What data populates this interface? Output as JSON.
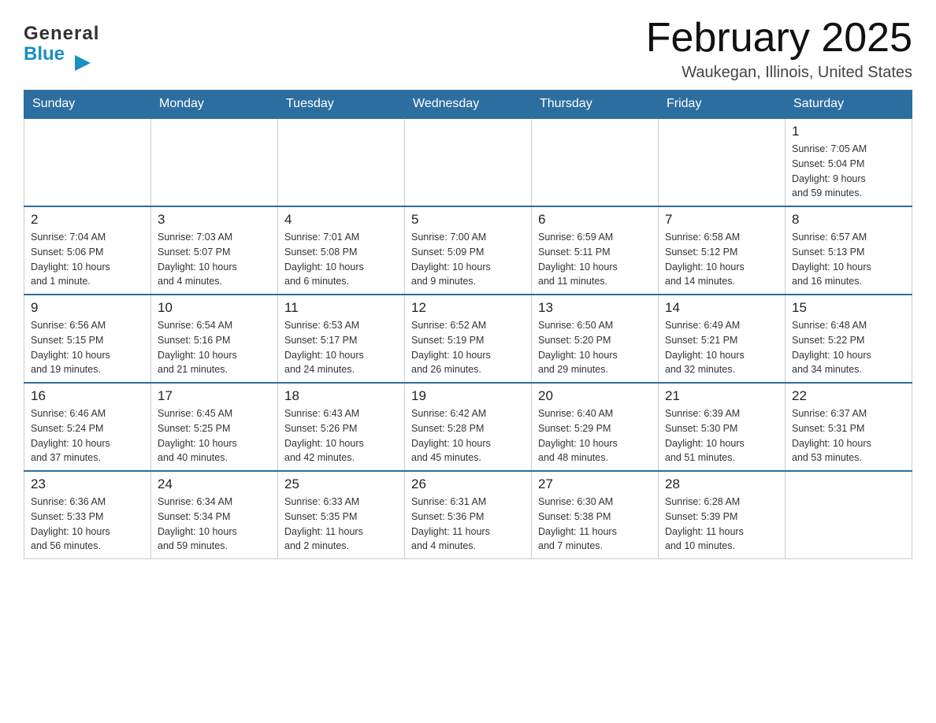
{
  "header": {
    "logo_general": "General",
    "logo_blue": "Blue",
    "title": "February 2025",
    "location": "Waukegan, Illinois, United States"
  },
  "days_of_week": [
    "Sunday",
    "Monday",
    "Tuesday",
    "Wednesday",
    "Thursday",
    "Friday",
    "Saturday"
  ],
  "weeks": [
    [
      {
        "day": "",
        "info": ""
      },
      {
        "day": "",
        "info": ""
      },
      {
        "day": "",
        "info": ""
      },
      {
        "day": "",
        "info": ""
      },
      {
        "day": "",
        "info": ""
      },
      {
        "day": "",
        "info": ""
      },
      {
        "day": "1",
        "info": "Sunrise: 7:05 AM\nSunset: 5:04 PM\nDaylight: 9 hours\nand 59 minutes."
      }
    ],
    [
      {
        "day": "2",
        "info": "Sunrise: 7:04 AM\nSunset: 5:06 PM\nDaylight: 10 hours\nand 1 minute."
      },
      {
        "day": "3",
        "info": "Sunrise: 7:03 AM\nSunset: 5:07 PM\nDaylight: 10 hours\nand 4 minutes."
      },
      {
        "day": "4",
        "info": "Sunrise: 7:01 AM\nSunset: 5:08 PM\nDaylight: 10 hours\nand 6 minutes."
      },
      {
        "day": "5",
        "info": "Sunrise: 7:00 AM\nSunset: 5:09 PM\nDaylight: 10 hours\nand 9 minutes."
      },
      {
        "day": "6",
        "info": "Sunrise: 6:59 AM\nSunset: 5:11 PM\nDaylight: 10 hours\nand 11 minutes."
      },
      {
        "day": "7",
        "info": "Sunrise: 6:58 AM\nSunset: 5:12 PM\nDaylight: 10 hours\nand 14 minutes."
      },
      {
        "day": "8",
        "info": "Sunrise: 6:57 AM\nSunset: 5:13 PM\nDaylight: 10 hours\nand 16 minutes."
      }
    ],
    [
      {
        "day": "9",
        "info": "Sunrise: 6:56 AM\nSunset: 5:15 PM\nDaylight: 10 hours\nand 19 minutes."
      },
      {
        "day": "10",
        "info": "Sunrise: 6:54 AM\nSunset: 5:16 PM\nDaylight: 10 hours\nand 21 minutes."
      },
      {
        "day": "11",
        "info": "Sunrise: 6:53 AM\nSunset: 5:17 PM\nDaylight: 10 hours\nand 24 minutes."
      },
      {
        "day": "12",
        "info": "Sunrise: 6:52 AM\nSunset: 5:19 PM\nDaylight: 10 hours\nand 26 minutes."
      },
      {
        "day": "13",
        "info": "Sunrise: 6:50 AM\nSunset: 5:20 PM\nDaylight: 10 hours\nand 29 minutes."
      },
      {
        "day": "14",
        "info": "Sunrise: 6:49 AM\nSunset: 5:21 PM\nDaylight: 10 hours\nand 32 minutes."
      },
      {
        "day": "15",
        "info": "Sunrise: 6:48 AM\nSunset: 5:22 PM\nDaylight: 10 hours\nand 34 minutes."
      }
    ],
    [
      {
        "day": "16",
        "info": "Sunrise: 6:46 AM\nSunset: 5:24 PM\nDaylight: 10 hours\nand 37 minutes."
      },
      {
        "day": "17",
        "info": "Sunrise: 6:45 AM\nSunset: 5:25 PM\nDaylight: 10 hours\nand 40 minutes."
      },
      {
        "day": "18",
        "info": "Sunrise: 6:43 AM\nSunset: 5:26 PM\nDaylight: 10 hours\nand 42 minutes."
      },
      {
        "day": "19",
        "info": "Sunrise: 6:42 AM\nSunset: 5:28 PM\nDaylight: 10 hours\nand 45 minutes."
      },
      {
        "day": "20",
        "info": "Sunrise: 6:40 AM\nSunset: 5:29 PM\nDaylight: 10 hours\nand 48 minutes."
      },
      {
        "day": "21",
        "info": "Sunrise: 6:39 AM\nSunset: 5:30 PM\nDaylight: 10 hours\nand 51 minutes."
      },
      {
        "day": "22",
        "info": "Sunrise: 6:37 AM\nSunset: 5:31 PM\nDaylight: 10 hours\nand 53 minutes."
      }
    ],
    [
      {
        "day": "23",
        "info": "Sunrise: 6:36 AM\nSunset: 5:33 PM\nDaylight: 10 hours\nand 56 minutes."
      },
      {
        "day": "24",
        "info": "Sunrise: 6:34 AM\nSunset: 5:34 PM\nDaylight: 10 hours\nand 59 minutes."
      },
      {
        "day": "25",
        "info": "Sunrise: 6:33 AM\nSunset: 5:35 PM\nDaylight: 11 hours\nand 2 minutes."
      },
      {
        "day": "26",
        "info": "Sunrise: 6:31 AM\nSunset: 5:36 PM\nDaylight: 11 hours\nand 4 minutes."
      },
      {
        "day": "27",
        "info": "Sunrise: 6:30 AM\nSunset: 5:38 PM\nDaylight: 11 hours\nand 7 minutes."
      },
      {
        "day": "28",
        "info": "Sunrise: 6:28 AM\nSunset: 5:39 PM\nDaylight: 11 hours\nand 10 minutes."
      },
      {
        "day": "",
        "info": ""
      }
    ]
  ]
}
